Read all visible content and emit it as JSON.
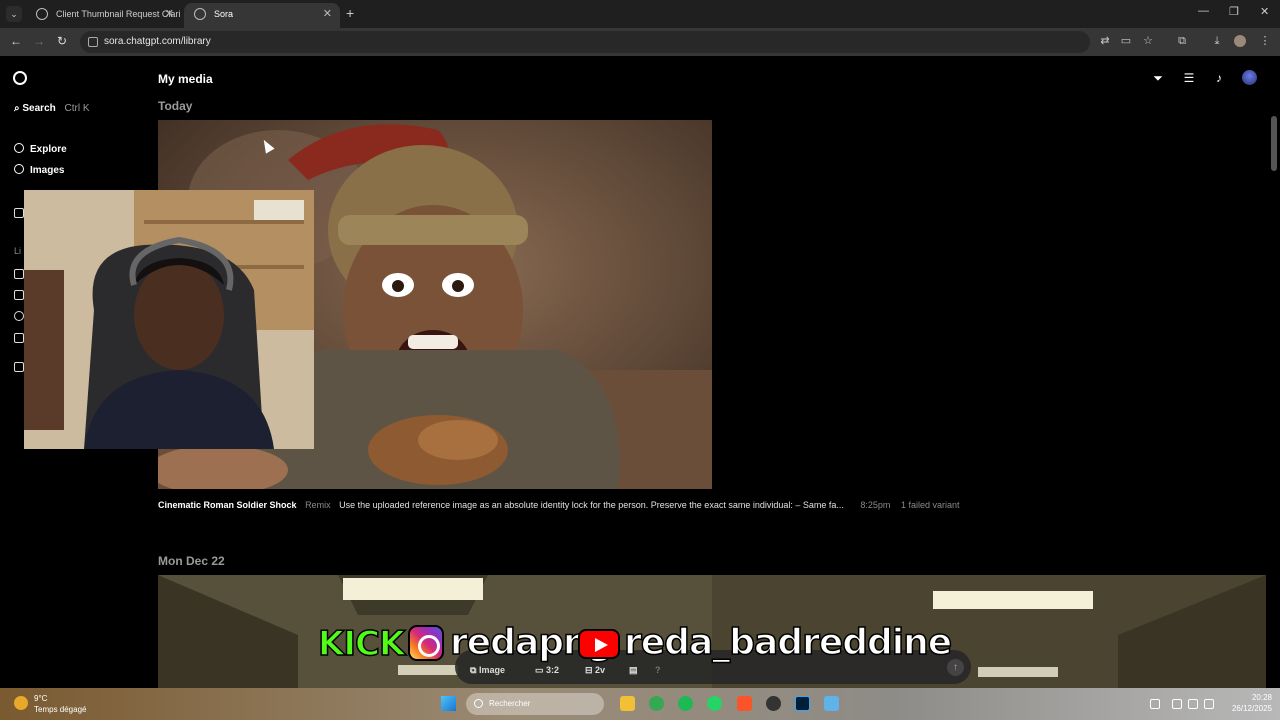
{
  "browser": {
    "tabs": [
      {
        "label": "Client Thumbnail Request Clari"
      },
      {
        "label": "Sora"
      }
    ],
    "url": "sora.chatgpt.com/library"
  },
  "sidebar": {
    "search_label": "Search",
    "search_shortcut": "Ctrl K",
    "items": [
      {
        "label": "Explore",
        "icon": "compass-icon"
      },
      {
        "label": "Images",
        "icon": "images-icon"
      }
    ],
    "library_label": "Li"
  },
  "main": {
    "title": "My media",
    "sections": [
      {
        "date": "Today",
        "media": {
          "title": "Cinematic Roman Soldier Shock",
          "tag": "Remix",
          "prompt": "Use the uploaded reference image as an absolute identity lock for the person. Preserve the exact same individual: – Same fa...",
          "time": "8:25pm",
          "status": "1 failed variant"
        }
      },
      {
        "date": "Mon Dec 22"
      }
    ]
  },
  "composer": {
    "type_label": "Image",
    "aspect_label": "3:2",
    "variants_label": "2v"
  },
  "banner": {
    "kick_label": "KICK",
    "instagram_handle": "redapng",
    "youtube_handle": "reda_badreddine"
  },
  "taskbar": {
    "weather_temp": "9°C",
    "weather_desc": "Temps dégagé",
    "search_placeholder": "Rechercher",
    "time": "20:28",
    "date": "26/12/2025"
  },
  "colors": {
    "background": "#000000",
    "kick_green": "#53fc18",
    "youtube_red": "#ff0000"
  }
}
